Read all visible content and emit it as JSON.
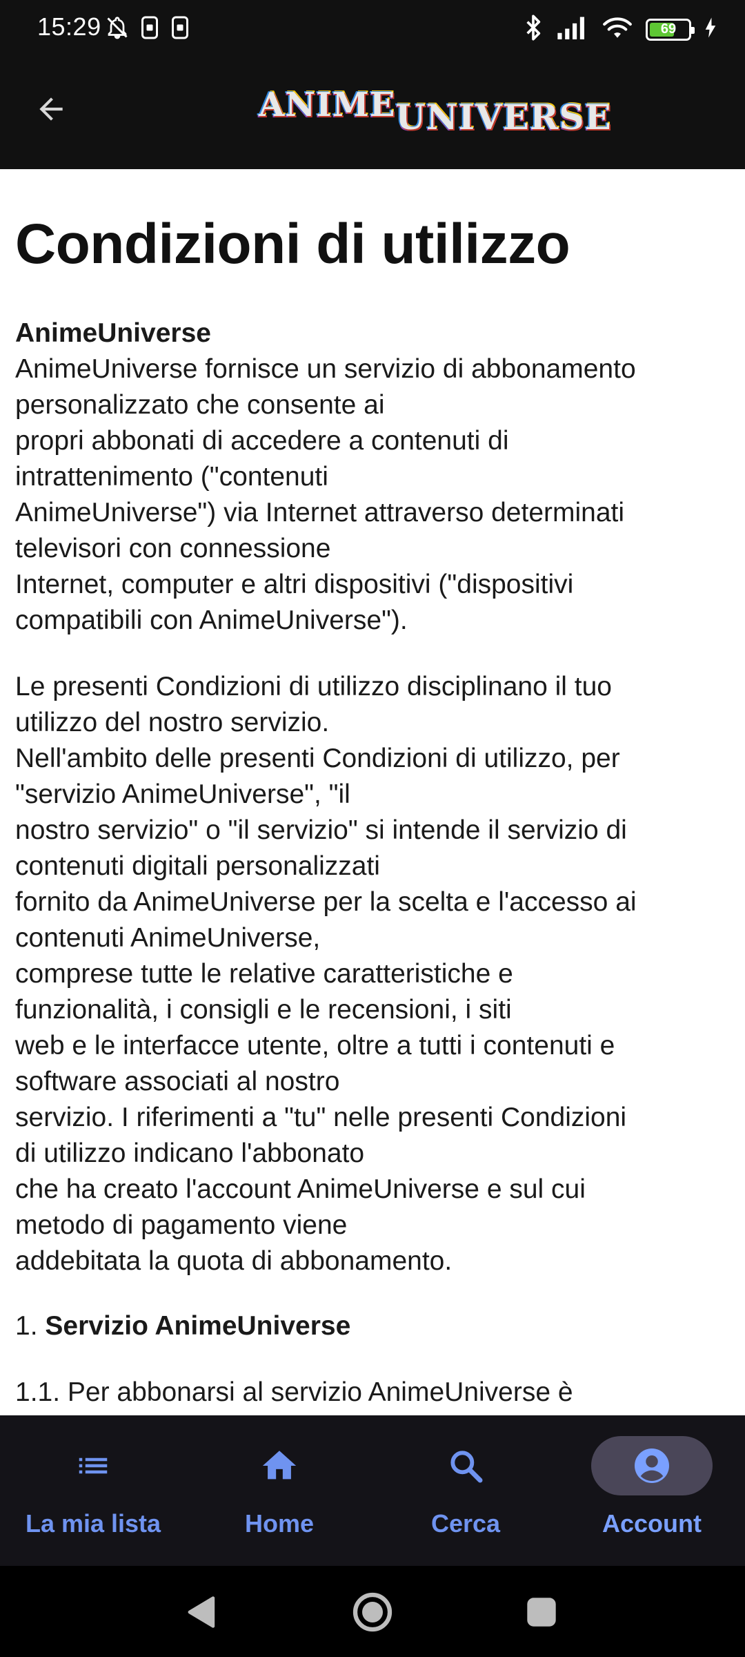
{
  "status_bar": {
    "time": "15:29",
    "battery_level": "69",
    "battery_fraction": 0.69,
    "icons": [
      "bell-off-icon",
      "sim-icon",
      "sim-icon",
      "bluetooth-icon",
      "signal-icon",
      "wifi-icon",
      "battery-icon",
      "charging-icon"
    ]
  },
  "app_bar": {
    "back_icon": "arrow-back-icon",
    "logo_part1": "ANIME",
    "logo_part2": "UNIVERSE"
  },
  "page": {
    "title": "Condizioni di utilizzo",
    "intro": {
      "heading": "AnimeUniverse",
      "lines": [
        "AnimeUniverse fornisce un servizio di abbonamento",
        "personalizzato che consente ai",
        "propri abbonati di accedere a contenuti di",
        "intrattenimento (\"contenuti",
        "AnimeUniverse\") via Internet attraverso determinati",
        "televisori con connessione",
        "Internet, computer e altri dispositivi (\"dispositivi",
        "compatibili con AnimeUniverse\")."
      ]
    },
    "terms": {
      "lines": [
        "Le presenti Condizioni di utilizzo disciplinano il tuo",
        "utilizzo del nostro servizio.",
        "Nell'ambito delle presenti Condizioni di utilizzo, per",
        "\"servizio AnimeUniverse\", \"il",
        "nostro servizio\" o \"il servizio\" si intende il servizio di",
        "contenuti digitali personalizzati",
        "fornito da AnimeUniverse per la scelta e l'accesso ai",
        "contenuti AnimeUniverse,",
        "comprese tutte le relative caratteristiche e",
        "funzionalità, i consigli e le recensioni, i siti",
        "web e le interfacce utente, oltre a tutti i contenuti e",
        "software associati al nostro",
        "servizio. I riferimenti a \"tu\" nelle presenti Condizioni",
        "di utilizzo indicano l'abbonato",
        "che ha creato l'account AnimeUniverse e sul cui",
        "metodo di pagamento viene",
        "addebitata la quota di abbonamento."
      ]
    },
    "section1": {
      "number": "1. ",
      "heading": "Servizio AnimeUniverse"
    },
    "section1_1": {
      "text": "1.1. Per abbonarsi al servizio AnimeUniverse è"
    }
  },
  "bottom_nav": {
    "items": [
      {
        "label": "La mia lista",
        "icon": "list-icon",
        "active": false
      },
      {
        "label": "Home",
        "icon": "home-icon",
        "active": false
      },
      {
        "label": "Cerca",
        "icon": "search-icon",
        "active": false
      },
      {
        "label": "Account",
        "icon": "account-circle-icon",
        "active": true
      }
    ]
  },
  "system_nav": {
    "buttons": [
      "back-triangle-icon",
      "home-circle-icon",
      "recents-square-icon"
    ]
  },
  "colors": {
    "bar_background": "#111111",
    "nav_background": "#141318",
    "accent": "#6f93f0",
    "active_pill": "#4a4658",
    "battery_fill": "#5ec634"
  }
}
